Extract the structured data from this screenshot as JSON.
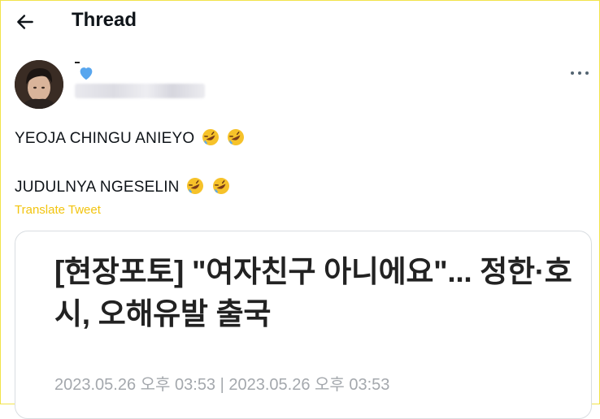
{
  "header": {
    "title": "Thread",
    "back_icon": "arrow-left-icon"
  },
  "tweet": {
    "verified_icon": "verified-badge-icon",
    "more_icon": "more-horizontal-icon",
    "line1": "YEOJA CHINGU ANIEYO",
    "line2": "JUDULNYA NGESELIN",
    "emoji_name": "rolling-on-floor-laughing-icon",
    "translate_label": "Translate Tweet",
    "card": {
      "headline": "[현장포토] \"여자친구 아니에요\"... 정한·호시, 오해유발 출국",
      "dateline": "2023.05.26 오후 03:53 | 2023.05.26 오후 03:53"
    }
  },
  "colors": {
    "accent": "#f2c40f",
    "verified": "#58a6ee",
    "frame": "#f2e34a"
  }
}
